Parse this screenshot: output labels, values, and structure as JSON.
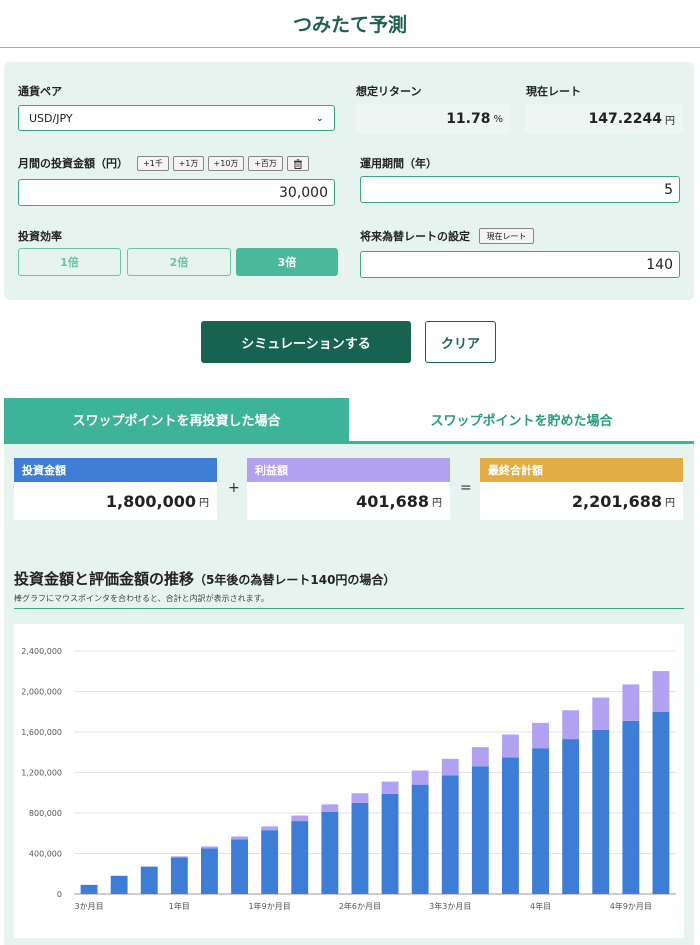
{
  "page_title": "つみたて予測",
  "form": {
    "currency_pair_label": "通貨ペア",
    "currency_pair_value": "USD/JPY",
    "expected_return_label": "想定リターン",
    "expected_return_value": "11.78",
    "expected_return_unit": "%",
    "current_rate_label": "現在レート",
    "current_rate_value": "147.2244",
    "current_rate_unit": "円",
    "monthly_amount_label": "月間の投資金額（円）",
    "quick_add": [
      "+1千",
      "+1万",
      "+10万",
      "+百万"
    ],
    "trash_icon": "trash-icon",
    "monthly_amount_value": "30,000",
    "period_label": "運用期間（年）",
    "period_value": "5",
    "efficiency_label": "投資効率",
    "efficiency_options": [
      "1倍",
      "2倍",
      "3倍"
    ],
    "efficiency_selected": "3倍",
    "future_rate_label": "将来為替レートの設定",
    "current_rate_button": "現在レート",
    "future_rate_value": "140"
  },
  "actions": {
    "simulate": "シミュレーションする",
    "clear": "クリア"
  },
  "tabs": [
    "スワップポイントを再投資した場合",
    "スワップポイントを貯めた場合"
  ],
  "summary": {
    "invested_label": "投資金額",
    "invested_value": "1,800,000",
    "profit_label": "利益額",
    "profit_value": "401,688",
    "total_label": "最終合計額",
    "total_value": "2,201,688",
    "unit": "円",
    "plus": "+",
    "equals": "="
  },
  "section": {
    "title": "投資金額と評価金額の推移",
    "subtitle": "（5年後の為替レート140円の場合）",
    "note": "棒グラフにマウスポインタを合わせると、合計と内訳が表示されます。"
  },
  "colors": {
    "invested": "#3d7dd6",
    "profit": "#b0a2f0",
    "total": "#e2ad44",
    "accent": "#3db499",
    "dark": "#17634f"
  },
  "chart_data": {
    "type": "bar",
    "stacked": true,
    "categories": [
      "3か月目",
      "6か月目",
      "9か月目",
      "1年目",
      "1年3か月目",
      "1年6か月目",
      "1年9か月目",
      "2年目",
      "2年3か月目",
      "2年6か月目",
      "2年9か月目",
      "3年目",
      "3年3か月目",
      "3年6か月目",
      "3年9か月目",
      "4年目",
      "4年3か月目",
      "4年6か月目",
      "4年9か月目",
      "5年目"
    ],
    "tick_labels": [
      "3か月目",
      "1年目",
      "1年9か月目",
      "2年6か月目",
      "3年3か月目",
      "4年目",
      "4年9か月目"
    ],
    "series": [
      {
        "values": [
          90000,
          180000,
          270000,
          360000,
          450000,
          540000,
          630000,
          720000,
          810000,
          900000,
          990000,
          1080000,
          1170000,
          1260000,
          1350000,
          1440000,
          1530000,
          1620000,
          1710000,
          1800000
        ]
      },
      {
        "values": [
          0,
          0,
          3000,
          12000,
          20000,
          28000,
          38000,
          55000,
          75000,
          95000,
          120000,
          140000,
          165000,
          190000,
          225000,
          250000,
          285000,
          320000,
          360000,
          401688
        ]
      }
    ],
    "ylim": [
      0,
      2400000
    ],
    "yticks": [
      "0",
      "400,000",
      "800,000",
      "1,200,000",
      "1,600,000",
      "2,000,000",
      "2,400,000"
    ],
    "grid": true
  }
}
